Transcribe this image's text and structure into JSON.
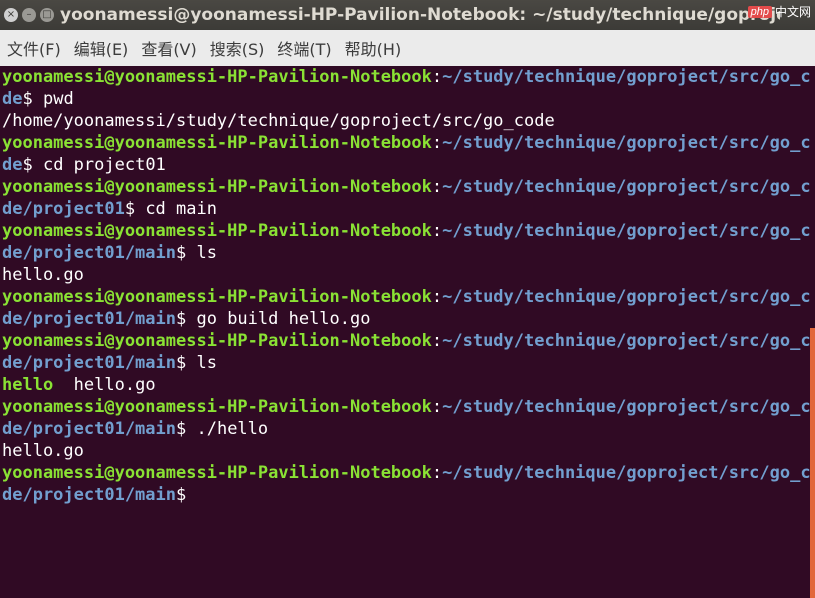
{
  "window": {
    "title": "yoonamessi@yoonamessi-HP-Pavilion-Notebook: ~/study/technique/goproject/src/go...",
    "close_glyph": "×",
    "min_glyph": "–",
    "max_glyph": "□"
  },
  "watermark": {
    "logo": "php",
    "text": "中文网"
  },
  "menu": [
    "文件(F)",
    "编辑(E)",
    "查看(V)",
    "搜索(S)",
    "终端(T)",
    "帮助(H)"
  ],
  "terminal": {
    "user_host": "yoonamessi@yoonamessi-HP-Pavilion-Notebook",
    "lines": [
      {
        "type": "prompt-wrap-top",
        "user": "yoonamessi@yoonamessi-HP-Pavilion-Notebook",
        "sep": ":",
        "path": "~/study/technique/goproject/src/go_co"
      },
      {
        "type": "prompt-wrap-bottom",
        "path": "de",
        "dollar": "$ ",
        "cmd": "pwd"
      },
      {
        "type": "output",
        "text": "/home/yoonamessi/study/technique/goproject/src/go_code"
      },
      {
        "type": "prompt-wrap-top",
        "user": "yoonamessi@yoonamessi-HP-Pavilion-Notebook",
        "sep": ":",
        "path": "~/study/technique/goproject/src/go_co"
      },
      {
        "type": "prompt-wrap-bottom",
        "path": "de",
        "dollar": "$ ",
        "cmd": "cd project01"
      },
      {
        "type": "prompt-wrap-top",
        "user": "yoonamessi@yoonamessi-HP-Pavilion-Notebook",
        "sep": ":",
        "path": "~/study/technique/goproject/src/go_co"
      },
      {
        "type": "prompt-wrap-bottom",
        "path": "de/project01",
        "dollar": "$ ",
        "cmd": "cd main"
      },
      {
        "type": "prompt-wrap-top",
        "user": "yoonamessi@yoonamessi-HP-Pavilion-Notebook",
        "sep": ":",
        "path": "~/study/technique/goproject/src/go_co"
      },
      {
        "type": "prompt-wrap-bottom",
        "path": "de/project01/main",
        "dollar": "$ ",
        "cmd": "ls"
      },
      {
        "type": "output",
        "text": "hello.go"
      },
      {
        "type": "prompt-wrap-top",
        "user": "yoonamessi@yoonamessi-HP-Pavilion-Notebook",
        "sep": ":",
        "path": "~/study/technique/goproject/src/go_co"
      },
      {
        "type": "prompt-wrap-bottom",
        "path": "de/project01/main",
        "dollar": "$ ",
        "cmd": "go build hello.go"
      },
      {
        "type": "prompt-wrap-top",
        "user": "yoonamessi@yoonamessi-HP-Pavilion-Notebook",
        "sep": ":",
        "path": "~/study/technique/goproject/src/go_co"
      },
      {
        "type": "prompt-wrap-bottom",
        "path": "de/project01/main",
        "dollar": "$ ",
        "cmd": "ls"
      },
      {
        "type": "ls-output",
        "exec": "hello",
        "gap": "  ",
        "file": "hello.go"
      },
      {
        "type": "prompt-wrap-top",
        "user": "yoonamessi@yoonamessi-HP-Pavilion-Notebook",
        "sep": ":",
        "path": "~/study/technique/goproject/src/go_co"
      },
      {
        "type": "prompt-wrap-bottom",
        "path": "de/project01/main",
        "dollar": "$ ",
        "cmd": "./hello"
      },
      {
        "type": "output",
        "text": "hello.go"
      },
      {
        "type": "prompt-wrap-top",
        "user": "yoonamessi@yoonamessi-HP-Pavilion-Notebook",
        "sep": ":",
        "path": "~/study/technique/goproject/src/go_co"
      },
      {
        "type": "prompt-wrap-bottom",
        "path": "de/project01/main",
        "dollar": "$",
        "cmd": ""
      }
    ]
  },
  "colors": {
    "background": "#300a24",
    "user": "#8ae234",
    "path": "#729fcf",
    "scroll_thumb": "#e2673a"
  }
}
